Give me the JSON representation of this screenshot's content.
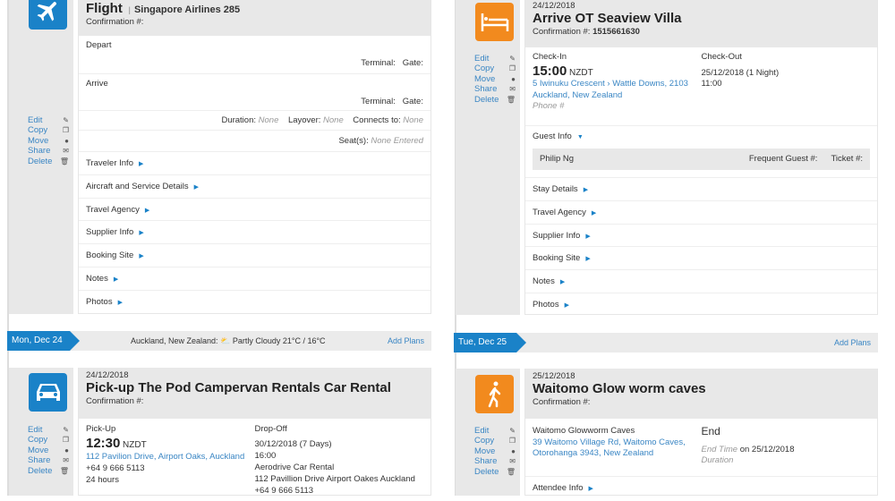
{
  "actions": {
    "edit": "Edit",
    "copy": "Copy",
    "move": "Move",
    "share": "Share",
    "delete": "Delete"
  },
  "flight": {
    "type": "Flight",
    "airline": "Singapore Airlines 285",
    "confirmation_label": "Confirmation #:",
    "depart": "Depart",
    "arrive": "Arrive",
    "terminal": "Terminal:",
    "gate": "Gate:",
    "duration_label": "Duration:",
    "duration": "None",
    "layover_label": "Layover:",
    "layover": "None",
    "connects_label": "Connects to:",
    "connects": "None",
    "seats_label": "Seat(s):",
    "seats": "None Entered",
    "sections": [
      "Traveler Info",
      "Aircraft and Service Details",
      "Travel Agency",
      "Supplier Info",
      "Booking Site",
      "Notes",
      "Photos"
    ]
  },
  "hotel": {
    "date": "24/12/2018",
    "title": "Arrive OT Seaview Villa",
    "confirmation_label": "Confirmation #:",
    "confirmation": "1515661630",
    "checkin_label": "Check-In",
    "time": "15:00",
    "tz": "NZDT",
    "address1": "5 Iwinuku Crescent",
    "address2": "Wattle Downs, 2103",
    "address3": "Auckland, New Zealand",
    "phone": "Phone #",
    "checkout_label": "Check-Out",
    "checkout_date": "25/12/2018 (1 Night)",
    "checkout_time": "11:00",
    "guest_info": "Guest Info",
    "guest_name": "Philip Ng",
    "frequent_guest": "Frequent Guest #:",
    "ticket": "Ticket #:",
    "sections": [
      "Stay Details",
      "Travel Agency",
      "Supplier Info",
      "Booking Site",
      "Notes",
      "Photos"
    ]
  },
  "day1": {
    "label": "Mon, Dec 24",
    "location": "Auckland, New Zealand:",
    "weather": "Partly Cloudy 21°C / 16°C",
    "add": "Add Plans"
  },
  "day2": {
    "label": "Tue, Dec 25",
    "add": "Add Plans"
  },
  "car": {
    "date": "24/12/2018",
    "title": "Pick-up The Pod Campervan Rentals Car Rental",
    "confirmation_label": "Confirmation #:",
    "pickup_label": "Pick-Up",
    "time": "12:30",
    "tz": "NZDT",
    "address": "112 Pavilion Drive, Airport Oaks, Auckland",
    "phone": "+64 9 666 5113",
    "hours": "24 hours",
    "dropoff_label": "Drop-Off",
    "drop_date": "30/12/2018 (7 Days)",
    "drop_time": "16:00",
    "drop_company": "Aerodrive Car Rental",
    "drop_address": "112 Pavillion Drive Airport Oakes Auckland",
    "drop_phone": "+64 9 666 5113"
  },
  "activity": {
    "date": "25/12/2018",
    "title": "Waitomo Glow worm caves",
    "confirmation_label": "Confirmation #:",
    "place": "Waitomo Glowworm Caves",
    "address1": "39 Waitomo Village Rd, Waitomo Caves,",
    "address2": "Otorohanga 3943, New Zealand",
    "end": "End",
    "end_time_label": "End Time",
    "end_on": "on 25/12/2018",
    "duration": "Duration",
    "attendee": "Attendee Info"
  }
}
